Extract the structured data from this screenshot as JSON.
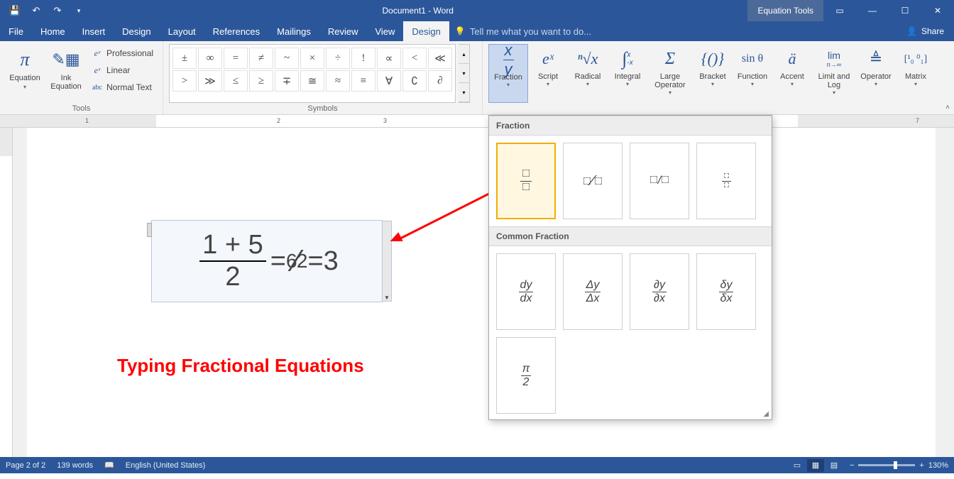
{
  "titlebar": {
    "doc_title": "Document1 - Word",
    "context_tab_title": "Equation Tools"
  },
  "win_controls": {
    "ribbon_opts": "▭",
    "min": "—",
    "max": "☐",
    "close": "✕"
  },
  "tabs": {
    "file": "File",
    "home": "Home",
    "insert": "Insert",
    "design1": "Design",
    "layout": "Layout",
    "references": "References",
    "mailings": "Mailings",
    "review": "Review",
    "view": "View",
    "eq_design": "Design",
    "tell_me_placeholder": "Tell me what you want to do...",
    "share": "Share"
  },
  "ribbon": {
    "tools": {
      "label": "Tools",
      "equation": "Equation",
      "ink_equation": "Ink\nEquation",
      "professional": "Professional",
      "linear": "Linear",
      "normal_text": "Normal Text"
    },
    "symbols": {
      "label": "Symbols",
      "row1": [
        "±",
        "∞",
        "=",
        "≠",
        "~",
        "×",
        "÷",
        "!",
        "∝",
        "<",
        "≪",
        ">"
      ],
      "row2": [
        "≫",
        "≤",
        "≥",
        "∓",
        "≅",
        "≈",
        "≡",
        "∀",
        "∁",
        "∂",
        "√",
        "∛"
      ]
    },
    "structures": {
      "fraction": "Fraction",
      "script": "Script",
      "radical": "Radical",
      "integral": "Integral",
      "large_operator": "Large\nOperator",
      "bracket": "Bracket",
      "function": "Function",
      "accent": "Accent",
      "limit_log": "Limit and\nLog",
      "operator": "Operator",
      "matrix": "Matrix"
    }
  },
  "gallery": {
    "section_fraction": "Fraction",
    "section_common": "Common Fraction",
    "common_items": [
      "dy/dx",
      "Δy/Δx",
      "∂y/∂x",
      "δy/δx",
      "π/2"
    ]
  },
  "equation": {
    "frac_num": "1 + 5",
    "frac_den": "2",
    "flat_num": "6",
    "flat_den": "2",
    "result": "3"
  },
  "caption": "Typing Fractional Equations",
  "ruler_ticks": [
    "1",
    "2",
    "3",
    "7"
  ],
  "status": {
    "page": "Page 2 of 2",
    "words": "139 words",
    "language": "English (United States)",
    "zoom": "130%"
  }
}
